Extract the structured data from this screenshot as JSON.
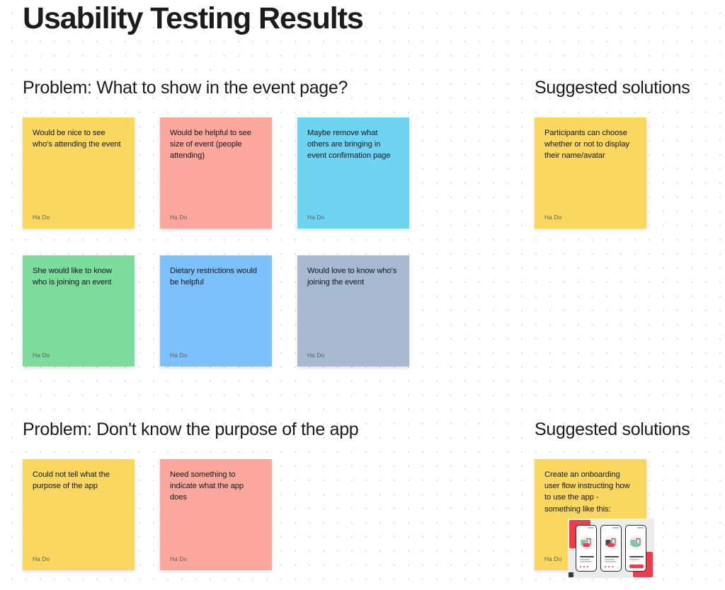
{
  "page": {
    "title": "Usability Testing Results"
  },
  "sections": [
    {
      "problem_heading": "Problem: What to show in the event page?",
      "solutions_heading": "Suggested solutions",
      "notes": [
        {
          "text": "Would be nice to see who's attending the event",
          "author": "Ha Do",
          "color": "#FAD75F"
        },
        {
          "text": "Would be helpful to see size of event (people attending)",
          "author": "Ha Do",
          "color": "#FBA79C"
        },
        {
          "text": "Maybe remove what others are bringing in event confirmation page",
          "author": "Ha Do",
          "color": "#6FD4F2"
        },
        {
          "text": "She would like to know who is joining an event",
          "author": "Ha Do",
          "color": "#7BDC9C"
        },
        {
          "text": "Dietary restrictions would be helpful",
          "author": "Ha Do",
          "color": "#7CC0FC"
        },
        {
          "text": "Would love to know who's joining the event",
          "author": "Ha Do",
          "color": "#A8B9D2"
        }
      ],
      "solutions": [
        {
          "text": "Participants can choose whether or not to display their name/avatar",
          "author": "Ha Do",
          "color": "#FAD75F"
        }
      ]
    },
    {
      "problem_heading": "Problem: Don't know the purpose of the app",
      "solutions_heading": "Suggested solutions",
      "notes": [
        {
          "text": "Could not tell what the purpose of the app",
          "author": "Ha Do",
          "color": "#FAD75F"
        },
        {
          "text": "Need something to indicate what the app does",
          "author": "Ha Do",
          "color": "#FBA79C"
        }
      ],
      "solutions": [
        {
          "text": "Create an onboarding user flow instructing how to use the app - something like this:",
          "author": "Ha Do",
          "color": "#FAD75F",
          "has_mockup": true
        }
      ]
    }
  ],
  "colors": {
    "yellow": "#FAD75F",
    "salmon": "#FBA79C",
    "cyan": "#6FD4F2",
    "green": "#7BDC9C",
    "blue": "#7CC0FC",
    "gray_blue": "#A8B9D2",
    "background": "#FFFFFF",
    "dot_grid": "#D9D9D9",
    "text": "#1C1C1C",
    "author_text": "#5D5D5D",
    "mockup_accent": "#EF3B4E"
  }
}
